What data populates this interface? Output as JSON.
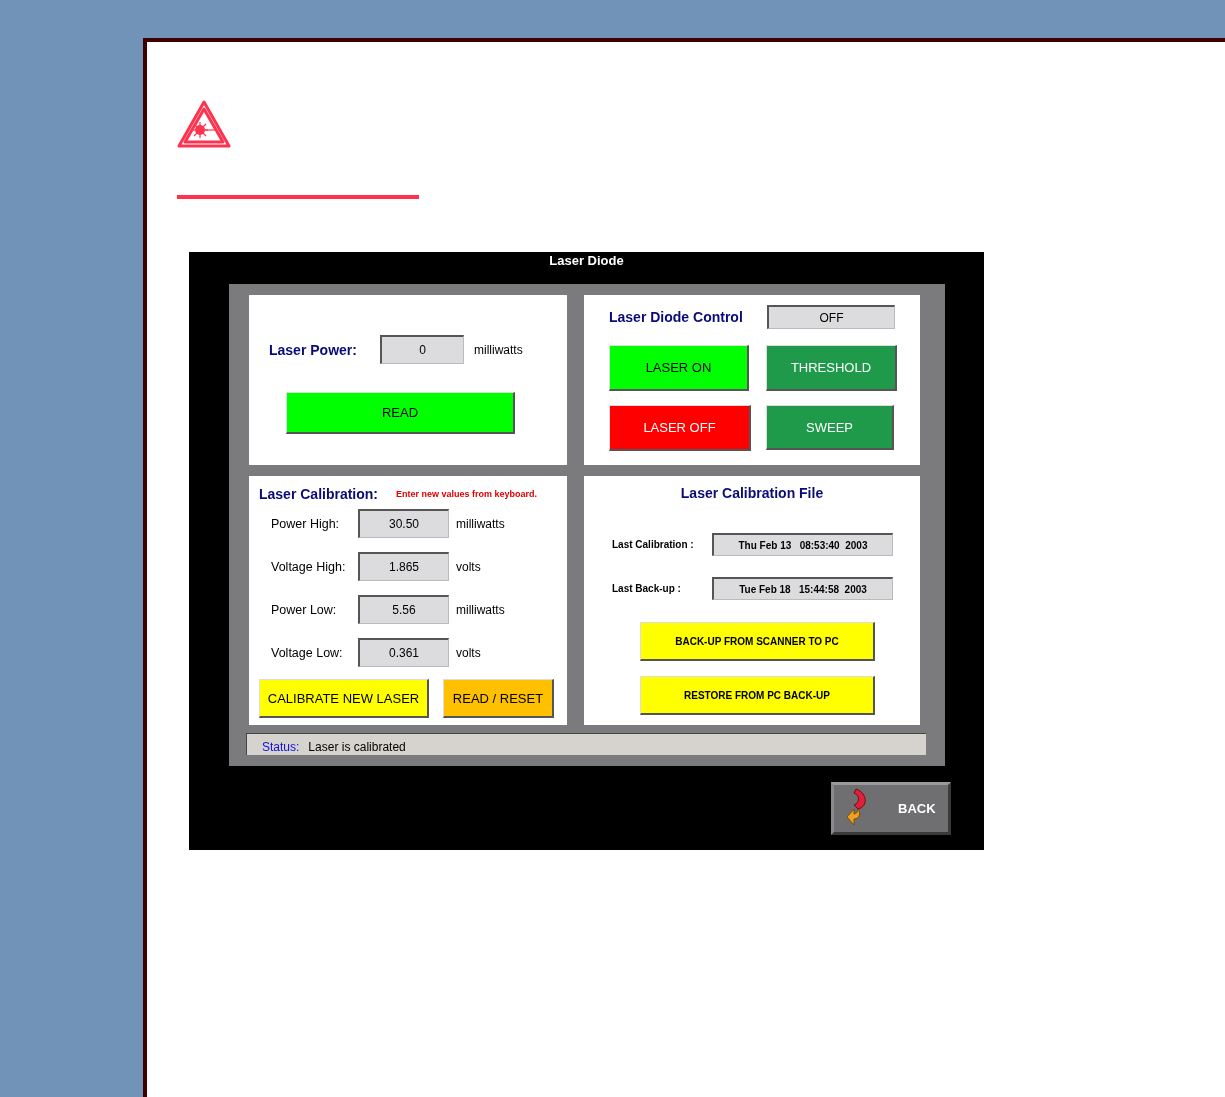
{
  "screen": {
    "title": "Laser Diode"
  },
  "laser_power": {
    "label": "Laser Power:",
    "value": "0",
    "unit": "milliwatts",
    "button": "READ"
  },
  "diode_control": {
    "label": "Laser Diode Control",
    "state": "OFF",
    "buttons": [
      {
        "label": "LASER ON",
        "color": "#00ff00"
      },
      {
        "label": "THRESHOLD",
        "color": "#1e9a4a"
      },
      {
        "label": "LASER OFF",
        "color": "#ff0000"
      },
      {
        "label": "SWEEP",
        "color": "#1e9a4a"
      }
    ]
  },
  "calibration": {
    "title": "Laser Calibration:",
    "hint": "Enter new values from keyboard.",
    "fields": [
      {
        "label": "Power High:",
        "value": "30.50",
        "unit": "milliwatts"
      },
      {
        "label": "Voltage High:",
        "value": "1.865",
        "unit": "volts"
      },
      {
        "label": "Power Low:",
        "value": "5.56",
        "unit": "milliwatts"
      },
      {
        "label": "Voltage Low:",
        "value": "0.361",
        "unit": "volts"
      }
    ],
    "buttons": [
      {
        "label": "CALIBRATE NEW LASER",
        "color": "#ffff00"
      },
      {
        "label": "READ / RESET",
        "color": "#ffc000"
      }
    ]
  },
  "calibration_file": {
    "title": "Laser Calibration File",
    "entries": [
      {
        "label": "Last Calibration :",
        "value": "Thu Feb 13   08:53:40  2003"
      },
      {
        "label": "Last Back-up :",
        "value": "Tue Feb 18   15:44:58  2003"
      }
    ],
    "buttons": [
      {
        "label": "BACK-UP FROM SCANNER TO PC",
        "color": "#ffff00"
      },
      {
        "label": "RESTORE FROM PC BACK-UP",
        "color": "#ffff00"
      }
    ]
  },
  "status_bar": {
    "label": "Status:",
    "text": "Laser is calibrated"
  },
  "back_button": "BACK"
}
